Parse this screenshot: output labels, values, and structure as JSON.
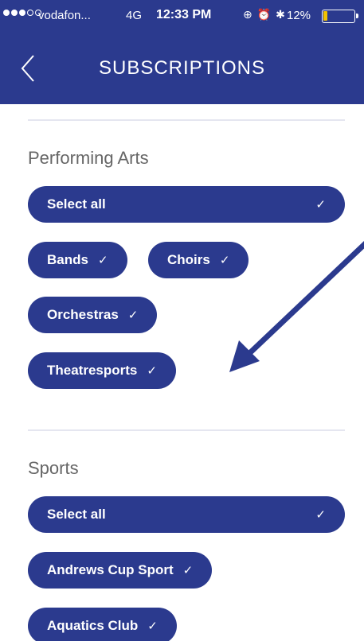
{
  "status_bar": {
    "carrier": "vodafon...",
    "network": "4G",
    "time": "12:33 PM",
    "battery": "12%",
    "signal_bars_filled": 3,
    "signal_bars_total": 5
  },
  "nav": {
    "title": "SUBSCRIPTIONS",
    "back_icon": "chevron-left-icon"
  },
  "sections": [
    {
      "heading": "Performing Arts",
      "select_all": "Select all",
      "items": [
        "Bands",
        "Choirs",
        "Orchestras",
        "Theatresports"
      ]
    },
    {
      "heading": "Sports",
      "select_all": "Select all",
      "items": [
        "Andrews Cup Sport",
        "Aquatics Club"
      ]
    }
  ],
  "check_glyph": "✓",
  "colors": {
    "brand": "#2b3a8e",
    "pill_text": "#ffffff",
    "heading_text": "#666666",
    "annotation_arrow": "#2b3a8e"
  }
}
